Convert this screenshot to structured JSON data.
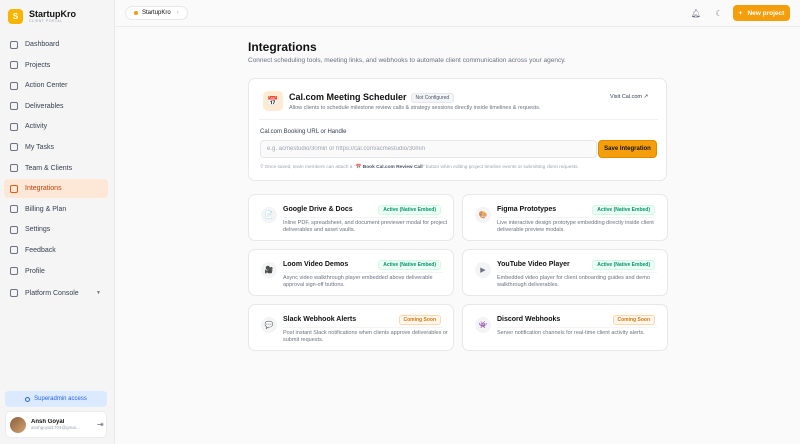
{
  "brand": {
    "logo_letter": "S",
    "name": "StartupKro",
    "subtitle": "CLIENT PORTAL"
  },
  "sidebar": {
    "items": [
      {
        "label": "Dashboard",
        "icon": "grid-icon"
      },
      {
        "label": "Projects",
        "icon": "folder-icon"
      },
      {
        "label": "Action Center",
        "icon": "inbox-icon"
      },
      {
        "label": "Deliverables",
        "icon": "package-icon"
      },
      {
        "label": "Activity",
        "icon": "pulse-icon"
      },
      {
        "label": "My Tasks",
        "icon": "check-icon"
      },
      {
        "label": "Team & Clients",
        "icon": "users-icon"
      },
      {
        "label": "Integrations",
        "icon": "plug-icon",
        "active": true
      },
      {
        "label": "Billing & Plan",
        "icon": "card-icon"
      },
      {
        "label": "Settings",
        "icon": "gear-icon"
      },
      {
        "label": "Feedback",
        "icon": "message-icon"
      },
      {
        "label": "Profile",
        "icon": "user-icon"
      },
      {
        "label": "Platform Console",
        "icon": "shield-icon"
      }
    ],
    "superadmin_label": "Superadmin access",
    "user": {
      "name": "Ansh Goyal",
      "email": "anshgoyal1704@gmai..."
    }
  },
  "topbar": {
    "workspace": "StartupKro",
    "new_project_label": "New project",
    "new_project_icon": "+"
  },
  "page": {
    "title": "Integrations",
    "subtitle": "Connect scheduling tools, meeting links, and webhooks to automate client communication across your agency."
  },
  "cal": {
    "icon": "📅",
    "title": "Cal.com Meeting Scheduler",
    "status": "Not Configured",
    "description": "Allow clients to schedule milestone review calls & strategy sessions directly inside timelines & requests.",
    "visit_label": "Visit Cal.com ↗",
    "field_label": "Cal.com Booking URL or Handle",
    "placeholder": "e.g. acmestudio/30min or https://cal.com/acmestudio/30min",
    "save_label": "Save Integration",
    "hint_prefix": "Once saved, team members can attach a \"",
    "hint_bold": "📅 Book Cal.com Review Call",
    "hint_suffix": "\" button when editing project timeline events or submitting client requests."
  },
  "integrations": [
    {
      "title": "Google Drive & Docs",
      "status": "Active (Native Embed)",
      "status_color": "#059669",
      "icon": "📄",
      "description": "Inline PDF, spreadsheet, and document previewer modal for project deliverables and asset vaults."
    },
    {
      "title": "Figma Prototypes",
      "status": "Active (Native Embed)",
      "status_color": "#059669",
      "icon": "🎨",
      "description": "Live interactive design prototype embedding directly inside client deliverable preview modals."
    },
    {
      "title": "Loom Video Demos",
      "status": "Active (Native Embed)",
      "status_color": "#059669",
      "icon": "🎥",
      "description": "Async video walkthrough player embedded above deliverable approval sign-off buttons."
    },
    {
      "title": "YouTube Video Player",
      "status": "Active (Native Embed)",
      "status_color": "#059669",
      "icon": "▶",
      "description": "Embedded video player for client onboarding guides and demo walkthrough deliverables."
    },
    {
      "title": "Slack Webhook Alerts",
      "status": "Coming Soon",
      "status_color": "#d97706",
      "icon": "💬",
      "description": "Post instant Slack notifications when clients approve deliverables or submit requests."
    },
    {
      "title": "Discord Webhooks",
      "status": "Coming Soon",
      "status_color": "#d97706",
      "icon": "👾",
      "description": "Server notification channels for real-time client activity alerts."
    }
  ]
}
